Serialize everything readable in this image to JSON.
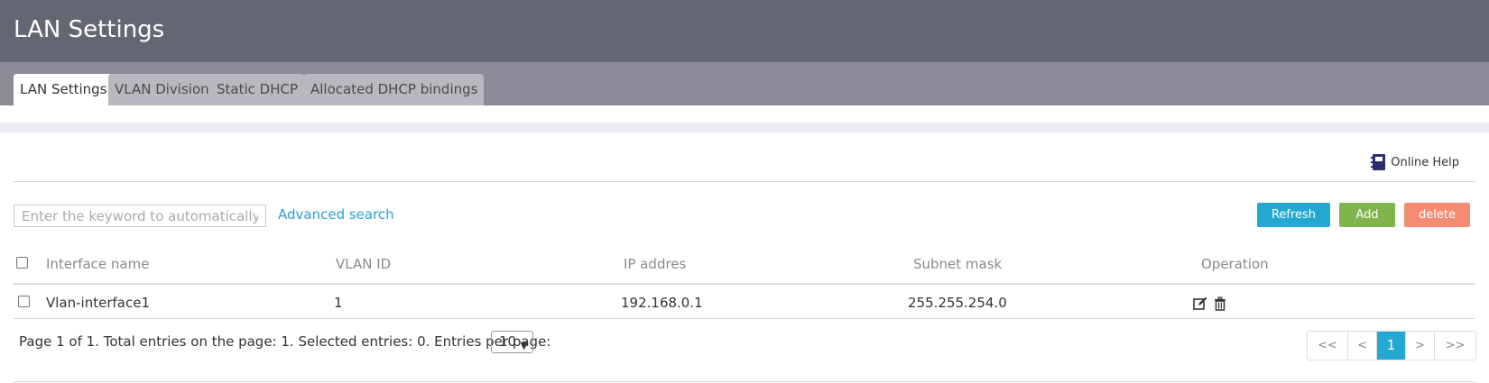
{
  "header": {
    "title": "LAN Settings"
  },
  "tabs": [
    {
      "label": "LAN Settings",
      "active": true
    },
    {
      "label": "VLAN Division",
      "active": false
    },
    {
      "label": "Static DHCP",
      "active": false
    },
    {
      "label": "Allocated DHCP bindings",
      "active": false
    }
  ],
  "help": {
    "label": "Online Help",
    "icon": "book-icon"
  },
  "search": {
    "placeholder": "Enter the keyword to automatically",
    "advanced_label": "Advanced search"
  },
  "toolbar": {
    "refresh_label": "Refresh",
    "add_label": "Add",
    "delete_label": "delete"
  },
  "table": {
    "headers": [
      "Interface name",
      "VLAN ID",
      "IP addres",
      "Subnet mask",
      "Operation"
    ],
    "rows": [
      {
        "interface": "Vlan-interface1",
        "vlan_id": "1",
        "ip": "192.168.0.1",
        "mask": "255.255.254.0",
        "icons": [
          "edit-icon",
          "trash-icon"
        ]
      }
    ]
  },
  "footer": {
    "summary": "Page 1 of 1. Total entries on the page: 1. Selected entries: 0. Entries per page:",
    "per_page": "10"
  },
  "pager": {
    "first": "<<",
    "prev": "<",
    "current": "1",
    "next": ">",
    "last": ">>"
  },
  "colors": {
    "header_bg": "#646673",
    "tabbar_bg": "#8c8b97",
    "accent": "#23a9d1",
    "add": "#81b54b",
    "delete": "#f38c73"
  }
}
